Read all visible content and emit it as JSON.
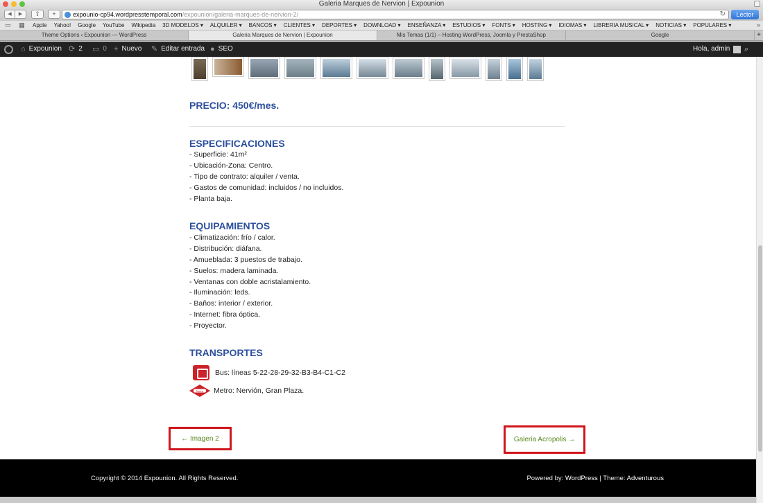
{
  "window": {
    "title": "Galeria Marques de Nervion | Expounion"
  },
  "toolbar": {
    "url_host": "expounio-cp94.wordpresstemporal.com",
    "url_path": "/expounion/galeria-marques-de-nervion-2/",
    "reader_label": "Lector"
  },
  "bookmarks": [
    "Apple",
    "Yahoo!",
    "Google",
    "YouTube",
    "Wikipedia",
    "3D MODELOS ▾",
    "ALQUILER ▾",
    "BANCOS ▾",
    "CLIENTES ▾",
    "DEPORTES ▾",
    "DOWNLOAD ▾",
    "ENSEÑANZA ▾",
    "ESTUDIOS ▾",
    "FONTS ▾",
    "HOSTING ▾",
    "IDIOMAS ▾",
    "LIBRERIA MUSICAL ▾",
    "NOTICIAS ▾",
    "POPULARES ▾"
  ],
  "tabs": [
    "Theme Options ‹ Expounion — WordPress",
    "Galeria Marques de Nervion | Expounion",
    "Mis Temas (1/1) – Hosting WordPress, Joomla y PrestaShop",
    "Google"
  ],
  "adminbar": {
    "site": "Expounion",
    "updates": "2",
    "comments": "0",
    "new_label": "Nuevo",
    "edit_label": "Editar entrada",
    "seo_label": "SEO",
    "greeting": "Hola, admin"
  },
  "content": {
    "price": "PRECIO: 450€/mes.",
    "specs_title": "ESPECIFICACIONES",
    "specs": [
      "- Superficie: 41m²",
      "- Ubicación-Zona: Centro.",
      "- Tipo de contrato: alquiler / venta.",
      "- Gastos de comunidad: incluidos / no incluidos.",
      "- Planta baja."
    ],
    "equip_title": "EQUIPAMIENTOS",
    "equip": [
      "- Climatización: frío / calor.",
      "- Distribución: diáfana.",
      "- Amueblada: 3 puestos de trabajo.",
      "- Suelos: madera laminada.",
      "- Ventanas con doble acristalamiento.",
      "- Iluminación: leds.",
      "- Baños: interior / exterior.",
      "- Internet: fibra óptica.",
      "- Proyector."
    ],
    "transport_title": "TRANSPORTES",
    "bus": "Bus: líneas 5-22-28-29-32-B3-B4-C1-C2",
    "metro": "Metro: Nervión, Gran Plaza.",
    "metro_logo_text": "Metro",
    "prev": "← Imagen 2",
    "next": "Galeria Acropolis →"
  },
  "footer": {
    "copyright_pre": "Copyright © 2014",
    "site": "Expounion",
    "copyright_post": ". All Rights Reserved.",
    "powered_pre": "Powered by:",
    "wordpress": "WordPress",
    "theme_pre": "| Theme:",
    "theme": "Adventurous"
  },
  "colors": {
    "heading": "#2c4f9e",
    "link_green": "#5a8a1e",
    "highlight_red": "#d0151b"
  }
}
